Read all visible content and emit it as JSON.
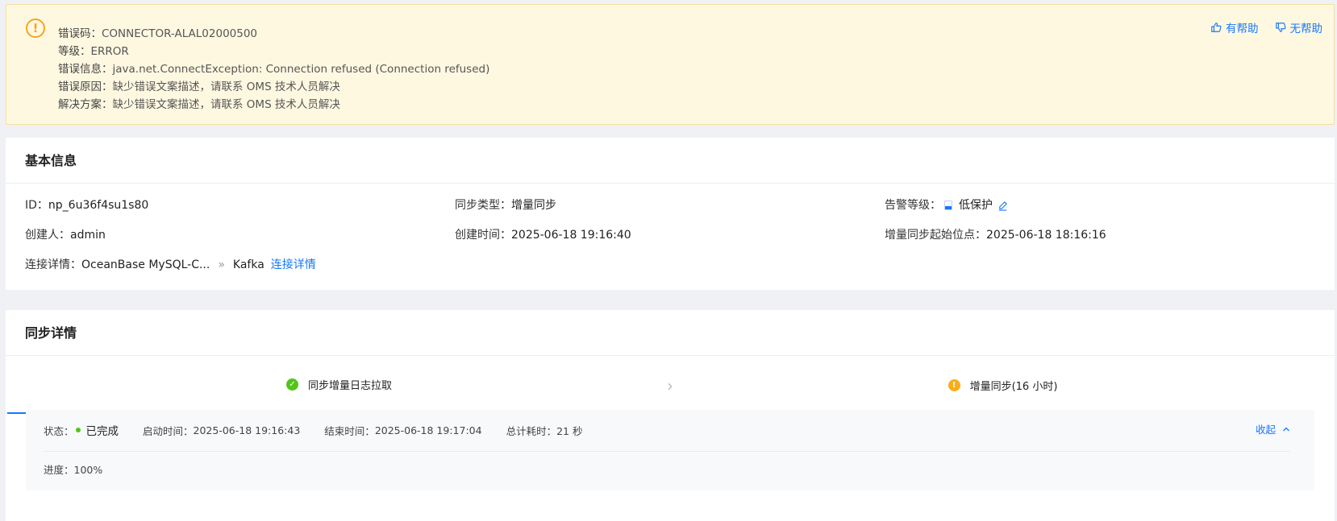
{
  "alert": {
    "icon": "warning-circle-icon",
    "accent_color": "#f5a623",
    "lines": [
      {
        "label": "错误码：",
        "value": "CONNECTOR-ALAL02000500"
      },
      {
        "label": "等级：",
        "value": "ERROR"
      },
      {
        "label": "错误信息：",
        "value": "java.net.ConnectException: Connection refused (Connection refused)"
      },
      {
        "label": "错误原因：",
        "value": "缺少错误文案描述，请联系 OMS 技术人员解决"
      },
      {
        "label": "解决方案：",
        "value": "缺少错误文案描述，请联系 OMS 技术人员解决"
      }
    ],
    "helpful_label": "有帮助",
    "not_helpful_label": "无帮助"
  },
  "basic_info": {
    "title": "基本信息",
    "id_label": "ID：",
    "id_value": "np_6u36f4su1s80",
    "sync_type_label": "同步类型：",
    "sync_type_value": "增量同步",
    "alert_level_label": "告警等级：",
    "alert_level_value": "低保护",
    "creator_label": "创建人：",
    "creator_value": "admin",
    "created_time_label": "创建时间：",
    "created_time_value": "2025-06-18 19:16:40",
    "incr_start_label": "增量同步起始位点：",
    "incr_start_value": "2025-06-18 18:16:16",
    "connection_label": "连接详情：",
    "source_value": "OceanBase MySQL-C...",
    "arrow": "»",
    "target_value": "Kafka",
    "connection_link": "连接详情"
  },
  "sync_detail": {
    "title": "同步详情",
    "steps": [
      {
        "label": "同步增量日志拉取",
        "status": "success",
        "color": "#52c41a"
      },
      {
        "label": "增量同步(16 小时)",
        "status": "warning",
        "color": "#faad14"
      }
    ],
    "status_label": "状态：",
    "status_value": "已完成",
    "start_label": "启动时间：",
    "start_value": "2025-06-18 19:16:43",
    "end_label": "结束时间：",
    "end_value": "2025-06-18 19:17:04",
    "duration_label": "总计耗时：",
    "duration_value": "21 秒",
    "collapse_label": "收起",
    "progress_label": "进度：",
    "progress_value": "100%"
  },
  "colors": {
    "primary": "#1677ff",
    "alert_bg": "#fff8e1",
    "page_bg": "#f0f1f4"
  }
}
